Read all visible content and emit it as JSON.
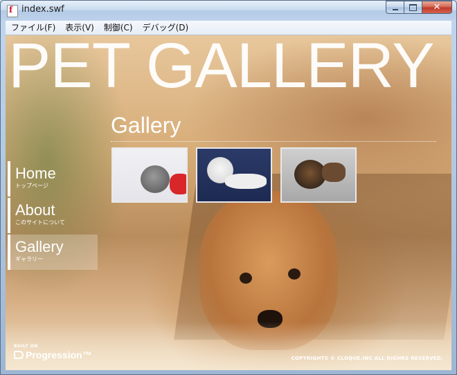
{
  "window": {
    "title": "index.swf"
  },
  "menu": [
    "ファイル(F)",
    "表示(V)",
    "制御(C)",
    "デバッグ(D)"
  ],
  "page": {
    "title": "PET GALLERY",
    "section_title": "Gallery",
    "nav": [
      {
        "label": "Home",
        "sub": "トップページ"
      },
      {
        "label": "About",
        "sub": "このサイトについて"
      },
      {
        "label": "Gallery",
        "sub": "ギャラリー"
      }
    ],
    "active_nav": "Gallery",
    "thumbnails": [
      {
        "icon": "kitten-photo"
      },
      {
        "icon": "french-bulldog-photo"
      },
      {
        "icon": "shiba-dog-photo"
      }
    ],
    "built_on": "BUILT ON",
    "brand": "Progression™",
    "copyright": "COPYRIGHTS © CLOQUE.INC ALL RIGHRS RESERVED."
  },
  "colors": {
    "text": "#ffffff",
    "close_button": "#c0392b"
  }
}
